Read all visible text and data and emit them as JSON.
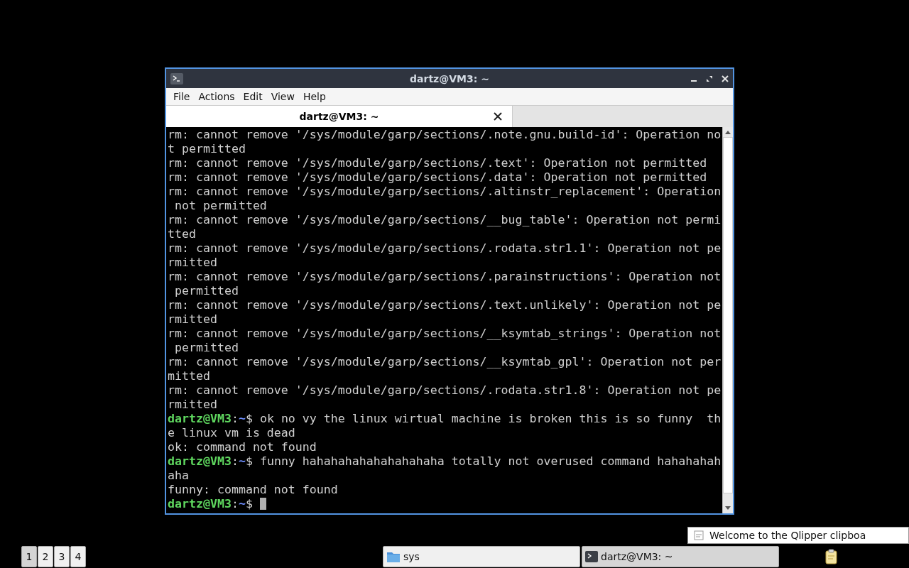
{
  "window": {
    "title": "dartz@VM3: ~"
  },
  "menu": [
    "File",
    "Actions",
    "Edit",
    "View",
    "Help"
  ],
  "tabs": [
    {
      "label": "dartz@VM3: ~",
      "selected": true
    }
  ],
  "terminal": {
    "lines": [
      {
        "kind": "output",
        "text": "rm: cannot remove '/sys/module/garp/sections/.note.gnu.build-id': Operation no"
      },
      {
        "kind": "output",
        "text": "t permitted"
      },
      {
        "kind": "output",
        "text": "rm: cannot remove '/sys/module/garp/sections/.text': Operation not permitted"
      },
      {
        "kind": "output",
        "text": "rm: cannot remove '/sys/module/garp/sections/.data': Operation not permitted"
      },
      {
        "kind": "output",
        "text": "rm: cannot remove '/sys/module/garp/sections/.altinstr_replacement': Operation"
      },
      {
        "kind": "output",
        "text": " not permitted"
      },
      {
        "kind": "output",
        "text": "rm: cannot remove '/sys/module/garp/sections/__bug_table': Operation not permi"
      },
      {
        "kind": "output",
        "text": "tted"
      },
      {
        "kind": "output",
        "text": "rm: cannot remove '/sys/module/garp/sections/.rodata.str1.1': Operation not pe"
      },
      {
        "kind": "output",
        "text": "rmitted"
      },
      {
        "kind": "output",
        "text": "rm: cannot remove '/sys/module/garp/sections/.parainstructions': Operation not"
      },
      {
        "kind": "output",
        "text": " permitted"
      },
      {
        "kind": "output",
        "text": "rm: cannot remove '/sys/module/garp/sections/.text.unlikely': Operation not pe"
      },
      {
        "kind": "output",
        "text": "rmitted"
      },
      {
        "kind": "output",
        "text": "rm: cannot remove '/sys/module/garp/sections/__ksymtab_strings': Operation not"
      },
      {
        "kind": "output",
        "text": " permitted"
      },
      {
        "kind": "output",
        "text": "rm: cannot remove '/sys/module/garp/sections/__ksymtab_gpl': Operation not per"
      },
      {
        "kind": "output",
        "text": "mitted"
      },
      {
        "kind": "output",
        "text": "rm: cannot remove '/sys/module/garp/sections/.rodata.str1.8': Operation not pe"
      },
      {
        "kind": "output",
        "text": "rmitted"
      },
      {
        "kind": "prompt",
        "user": "dartz@VM3",
        "colon": ":",
        "path": "~",
        "sign": "$ ",
        "command": "ok no vy the linux wirtual machine is broken this is so funny  th",
        "cursor": false
      },
      {
        "kind": "output",
        "text": "e linux vm is dead"
      },
      {
        "kind": "output",
        "text": "ok: command not found"
      },
      {
        "kind": "prompt",
        "user": "dartz@VM3",
        "colon": ":",
        "path": "~",
        "sign": "$ ",
        "command": "funny hahahahahahahahahaha totally not overused command hahahahah",
        "cursor": false
      },
      {
        "kind": "output",
        "text": "aha"
      },
      {
        "kind": "output",
        "text": "funny: command not found"
      },
      {
        "kind": "prompt",
        "user": "dartz@VM3",
        "colon": ":",
        "path": "~",
        "sign": "$ ",
        "cursor": true
      }
    ]
  },
  "notification": {
    "text": "Welcome to the Qlipper clipboa"
  },
  "taskbar": {
    "desktops": [
      {
        "label": "1",
        "selected": true
      },
      {
        "label": "2",
        "selected": false
      },
      {
        "label": "3",
        "selected": false
      },
      {
        "label": "4",
        "selected": false
      }
    ],
    "tasks": [
      {
        "kind": "folder",
        "label": "sys",
        "selected": false
      },
      {
        "kind": "terminal",
        "label": "dartz@VM3: ~",
        "selected": true
      }
    ]
  }
}
